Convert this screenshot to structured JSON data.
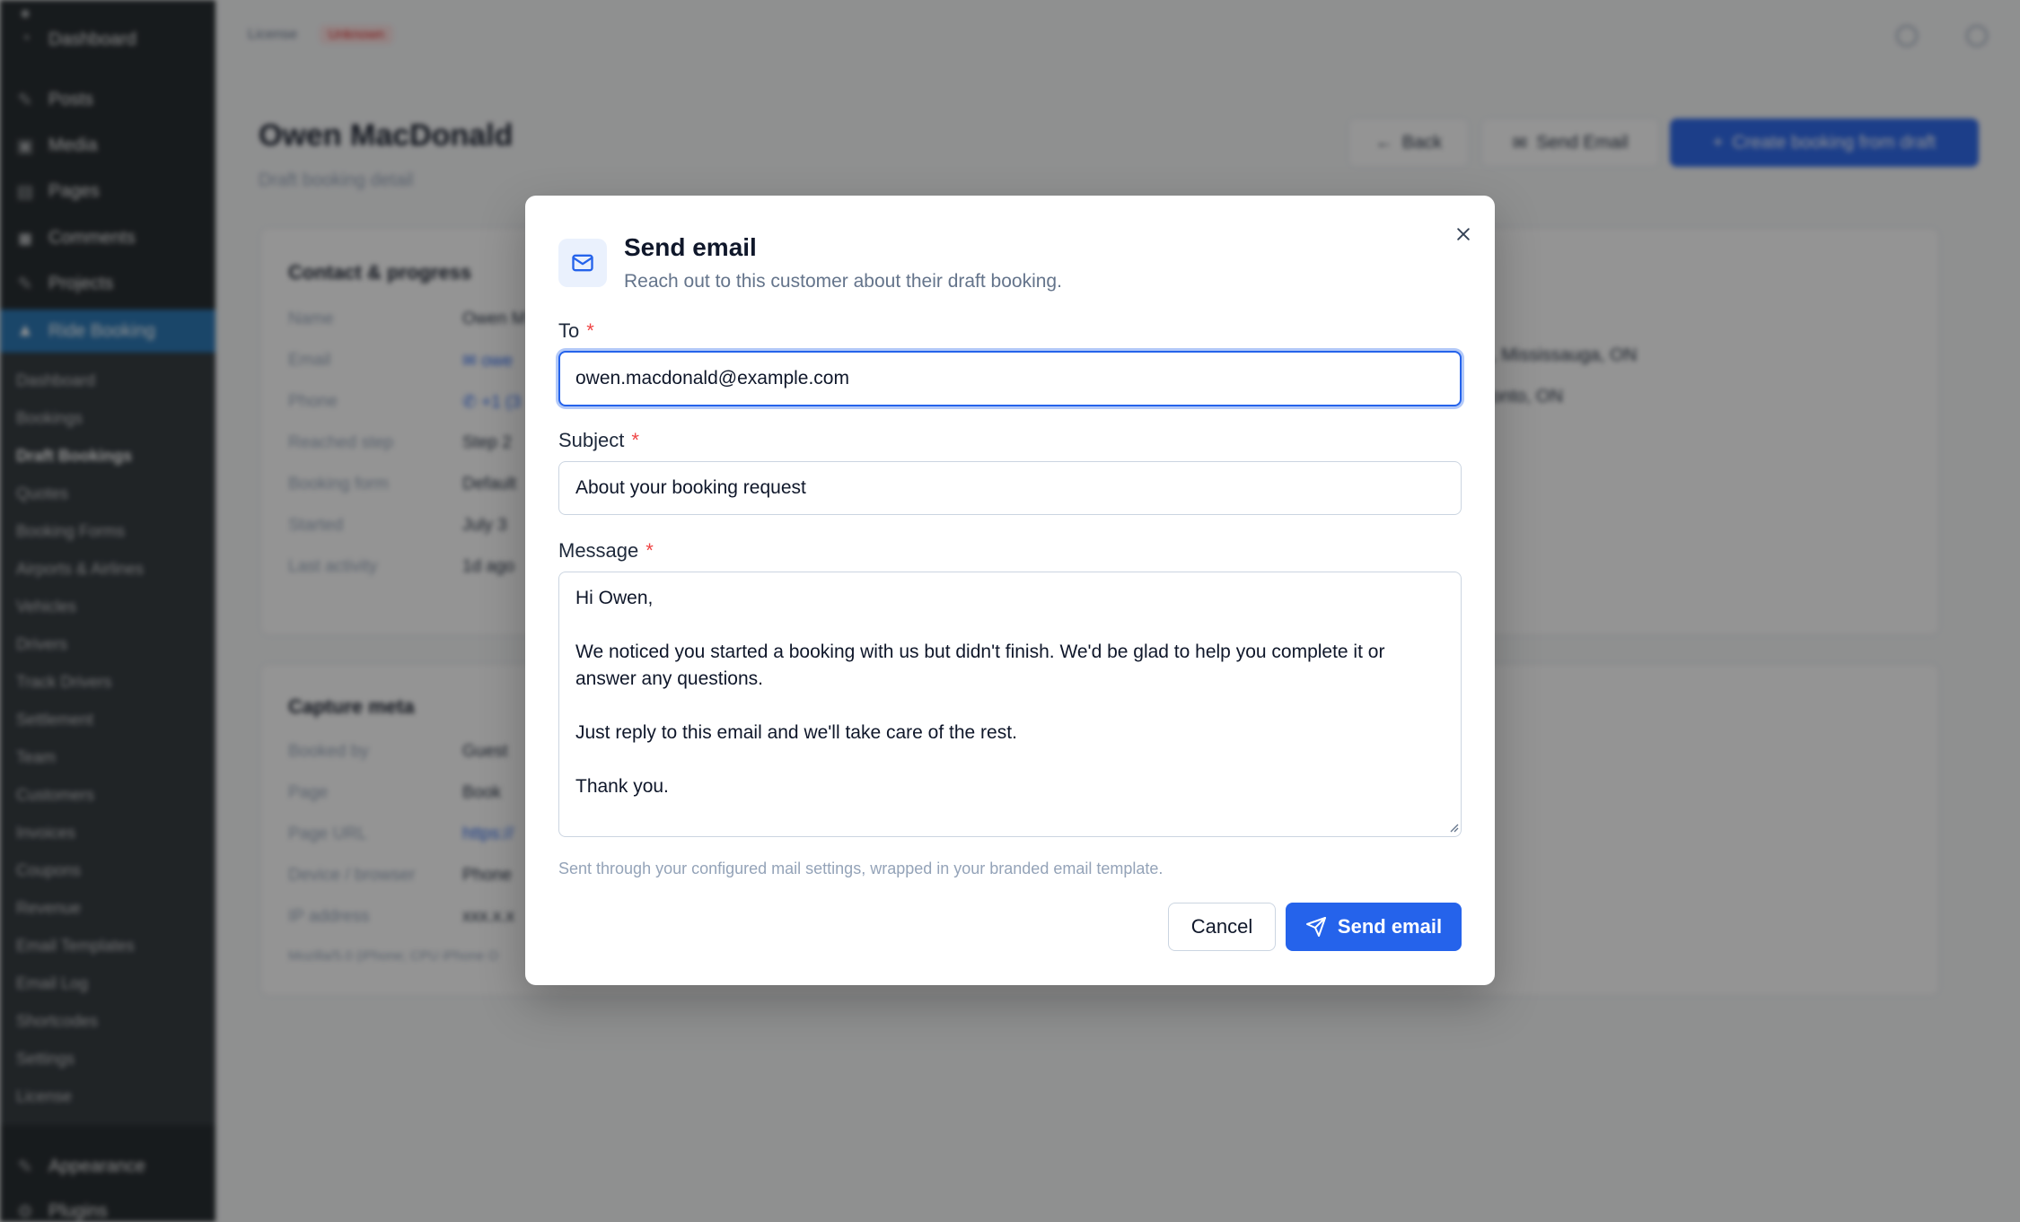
{
  "sidebar": {
    "top_items": [
      {
        "label": "Dashboard",
        "icon": "dashboard-icon"
      },
      {
        "label": "Posts",
        "icon": "pin-icon"
      },
      {
        "label": "Media",
        "icon": "media-icon"
      },
      {
        "label": "Pages",
        "icon": "pages-icon"
      },
      {
        "label": "Comments",
        "icon": "comment-icon"
      },
      {
        "label": "Projects",
        "icon": "pin-icon"
      },
      {
        "label": "Ride Booking",
        "icon": "car-icon"
      }
    ],
    "sub_items": [
      "Dashboard",
      "Bookings",
      "Draft Bookings",
      "Quotes",
      "Booking Forms",
      "Airports & Airlines",
      "Vehicles",
      "Drivers",
      "Track Drivers",
      "Settlement",
      "Team",
      "Customers",
      "Invoices",
      "Coupons",
      "Revenue",
      "Email Templates",
      "Email Log",
      "Shortcodes",
      "Settings",
      "License"
    ],
    "bottom_items": [
      {
        "label": "Appearance",
        "icon": "brush-icon"
      },
      {
        "label": "Plugins",
        "icon": "plugin-icon"
      }
    ]
  },
  "page": {
    "license_label": "License",
    "license_status": "Unknown",
    "title": "Owen MacDonald",
    "subtitle": "Draft booking detail",
    "back_label": "Back",
    "send_email_label": "Send Email",
    "create_label": "Create booking from draft"
  },
  "contact_card": {
    "title": "Contact & progress",
    "rows": [
      {
        "key": "Name",
        "value": "Owen M"
      },
      {
        "key": "Email",
        "value": "✉ owe"
      },
      {
        "key": "Phone",
        "value": "✆ +1 (3"
      },
      {
        "key": "Reached step",
        "value": "Step 2"
      },
      {
        "key": "Booking form",
        "value": "Default"
      },
      {
        "key": "Started",
        "value": "July 3"
      },
      {
        "key": "Last activity",
        "value": "1d ago"
      }
    ],
    "address_1": ", Mississauga, ON",
    "address_2": "onto, ON"
  },
  "meta_card": {
    "title": "Capture meta",
    "rows": [
      {
        "key": "Booked by",
        "value": "Guest"
      },
      {
        "key": "Page",
        "value": "Book"
      },
      {
        "key": "Page URL",
        "value": "https://"
      },
      {
        "key": "Device / browser",
        "value": "Phone"
      },
      {
        "key": "IP address",
        "value": "xxx.x.x"
      }
    ],
    "user_agent": "Mozilla/5.0 (iPhone; CPU iPhone O"
  },
  "modal": {
    "title": "Send email",
    "description": "Reach out to this customer about their draft booking.",
    "to_label": "To",
    "to_value": "owen.macdonald@example.com",
    "subject_label": "Subject",
    "subject_value": "About your booking request",
    "message_label": "Message",
    "message_value": "Hi Owen,\n\nWe noticed you started a booking with us but didn't finish. We'd be glad to help you complete it or answer any questions.\n\nJust reply to this email and we'll take care of the rest.\n\nThank you.",
    "required_mark": "*",
    "hint": "Sent through your configured mail settings, wrapped in your branded email template.",
    "cancel_label": "Cancel",
    "send_label": "Send email"
  },
  "colors": {
    "primary": "#2563eb",
    "required": "#ef4444",
    "sidebar_bg": "#1d2327",
    "overlay": "rgba(17,17,17,0.45)"
  }
}
